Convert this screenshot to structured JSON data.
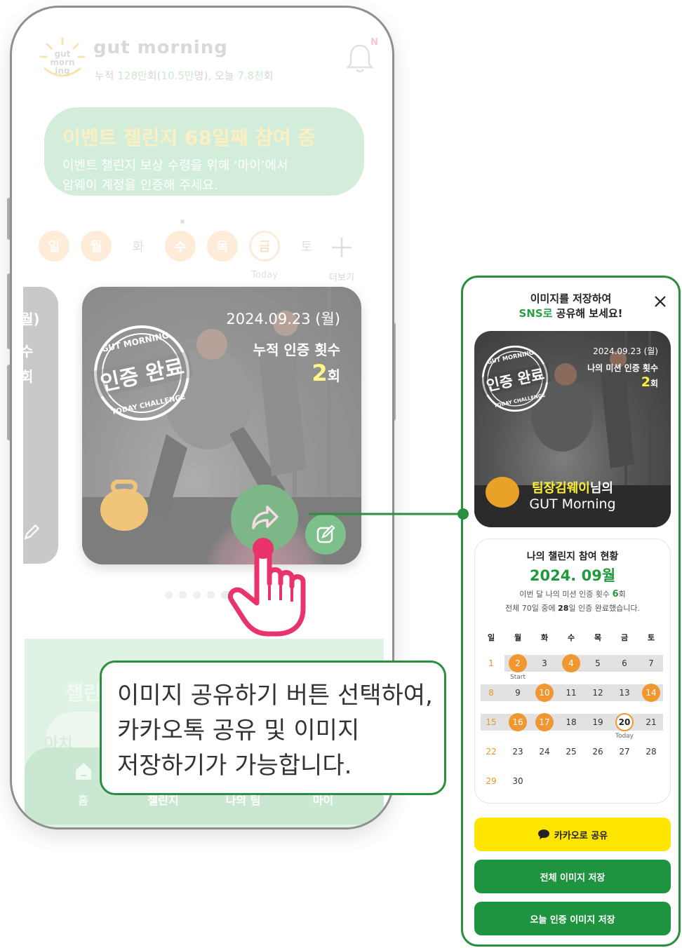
{
  "header": {
    "logo_mark_lines": [
      "gut",
      "morn",
      "ing"
    ],
    "logo_text": "gut morning",
    "stats_prefix": "누적 ",
    "stats_total": "128만",
    "stats_mid1": "회(",
    "stats_users": "10.5만",
    "stats_mid2": "명), 오늘 ",
    "stats_today": "7.8천",
    "stats_suffix": "회",
    "bell_badge": "N"
  },
  "event": {
    "title": "이벤트 챌린지 68일째 참여 중",
    "desc_line1": "이벤트 챌린지 보상 수령을 위해 ‘마이’에서",
    "desc_line2": "암웨이 계정을 인증해 주세요."
  },
  "week": {
    "days": [
      "일",
      "월",
      "화",
      "수",
      "목",
      "금",
      "토"
    ],
    "today_label": "Today",
    "more_label": "더보기"
  },
  "prev_card": {
    "l1": "월)",
    "l2": "수",
    "l3": "회"
  },
  "cert_card": {
    "date": "2024.09.23 (월)",
    "count_label": "누적 인증 횟수",
    "count_value": "2",
    "count_unit": "회",
    "stamp_top": "GUT MORNING",
    "stamp_main": "인증 완료",
    "stamp_bottom": "TODAY CHALLENGE"
  },
  "challenge": {
    "title": "챌린",
    "pill": "아치"
  },
  "nav": {
    "home": "홈",
    "challenge": "챌린지",
    "team": "나의 팀",
    "my": "마이"
  },
  "callout": {
    "line1": "이미지 공유하기 버튼 선택하여,",
    "line2": "카카오톡 공유 및 이미지",
    "line3": "저장하기가 가능합니다."
  },
  "modal": {
    "head_line1": "이미지를 저장하여",
    "head_green": "SNS로",
    "head_rest": " 공유해 보세요!",
    "photo": {
      "date": "2024.09.23 (월)",
      "label": "나의 미션 인증 횟수",
      "count": "2",
      "unit": "회",
      "name_yellow": "팀장김웨이",
      "name_rest": "님의",
      "sub": "GUT Morning"
    },
    "status": {
      "title": "나의 챌린지 참여 현황",
      "month": "2024. 09월",
      "line1_pre": "이번 달 나의 미션 인증 횟수 ",
      "line1_num": "6",
      "line1_post": "회",
      "line2_pre": "전체 70일 중에 ",
      "line2_num": "28",
      "line2_post": "일 인증 완료했습니다."
    },
    "calendar": {
      "weekdays": [
        "일",
        "월",
        "화",
        "수",
        "목",
        "금",
        "토"
      ],
      "start_label": "Start",
      "today_label": "Today",
      "rows": [
        [
          "1",
          "2",
          "3",
          "4",
          "5",
          "6",
          "7"
        ],
        [
          "8",
          "9",
          "10",
          "11",
          "12",
          "13",
          "14"
        ],
        [
          "15",
          "16",
          "17",
          "18",
          "19",
          "20",
          "21"
        ],
        [
          "22",
          "23",
          "24",
          "25",
          "26",
          "27",
          "28"
        ],
        [
          "29",
          "30",
          "",
          "",
          "",
          "",
          ""
        ]
      ],
      "done_days": [
        "2",
        "4",
        "10",
        "14",
        "16",
        "17"
      ],
      "today_day": "20"
    },
    "btn_kakao": "카카오로 공유",
    "btn_all": "전체 이미지 저장",
    "btn_today": "오늘 인증 이미지 저장"
  },
  "colors": {
    "brand_green": "#1e9440",
    "kakao_yellow": "#fee500",
    "done_orange": "#f0982f",
    "accent_yellow": "#fff13a"
  }
}
